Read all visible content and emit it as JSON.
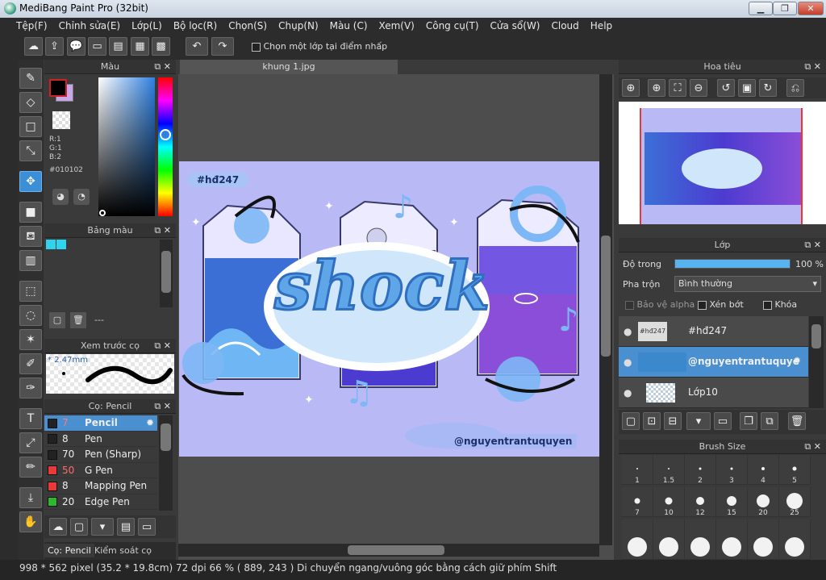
{
  "title": "MediBang Paint Pro (32bit)",
  "window_buttons": {
    "minimize": "▁",
    "maximize": "❐",
    "close": "✕"
  },
  "menu": [
    "Tệp(F)",
    "Chỉnh sửa(E)",
    "Lớp(L)",
    "Bộ lọc(R)",
    "Chọn(S)",
    "Chụp(N)",
    "Màu (C)",
    "Xem(V)",
    "Công cụ(T)",
    "Cửa sổ(W)",
    "Cloud",
    "Help"
  ],
  "toolbar": {
    "select_layer_label": "Chọn một lớp tại điểm nhấp"
  },
  "color_panel": {
    "title": "Màu",
    "r": "R:1",
    "g": "G:1",
    "b": "B:2",
    "hex": "#010102",
    "fg_color": "#010102",
    "bg_color": "#c8a7e8"
  },
  "palette_panel": {
    "title": "Bảng màu",
    "value": "---",
    "swatch1": "#2fd3ee",
    "swatch2": "#2fd3ee"
  },
  "brush_preview": {
    "title": "Xem trước cọ",
    "size": "2.47mm"
  },
  "brush_panel": {
    "title": "Cọ: Pencil",
    "items": [
      {
        "size": "7",
        "name": "Pencil",
        "color": "#222222",
        "size_color": "#ff7a7a"
      },
      {
        "size": "8",
        "name": "Pen",
        "color": "#222222",
        "size_color": "#eeeeee"
      },
      {
        "size": "70",
        "name": "Pen (Sharp)",
        "color": "#222222",
        "size_color": "#eeeeee"
      },
      {
        "size": "50",
        "name": "G Pen",
        "color": "#e83a3a",
        "size_color": "#ff6b6b"
      },
      {
        "size": "8",
        "name": "Mapping Pen",
        "color": "#e83a3a",
        "size_color": "#eeeeee"
      },
      {
        "size": "20",
        "name": "Edge Pen",
        "color": "#2cb82c",
        "size_color": "#eeeeee"
      }
    ],
    "tabs": [
      "Cọ: Pencil",
      "Kiểm soát cọ"
    ]
  },
  "document_tab": "khung 1.jpg",
  "artwork": {
    "hashtag": "#hđ247",
    "main_text": "shock",
    "watermark": "@nguyentrantuquyen",
    "bg": "#b9b9f5"
  },
  "navigator": {
    "title": "Hoa tiêu"
  },
  "layer_panel": {
    "title": "Lớp",
    "opacity_label": "Độ trong",
    "opacity_value": "100 %",
    "opacity_fraction": 1.0,
    "blend_label": "Pha trộn",
    "blend_value": "Bình thường",
    "protect_alpha": "Bảo vệ alpha",
    "clipping": "Xén bớt",
    "lock": "Khóa",
    "layers": [
      {
        "name": "#hđ247",
        "thumb_text": "#hđ247"
      },
      {
        "name": "@nguyentrantuquye"
      },
      {
        "name": "Lớp10"
      }
    ]
  },
  "brush_size": {
    "title": "Brush Size",
    "sizes": [
      "1",
      "1.5",
      "2",
      "3",
      "4",
      "5",
      "7",
      "10",
      "12",
      "15",
      "20",
      "25"
    ]
  },
  "status": {
    "pixels": "998 * 562 pixel",
    "cm": "(35.2 * 19.8cm)",
    "dpi": "72 dpi",
    "zoom": "66 %",
    "coords": "( 889, 243 )",
    "hint": "Di chuyển ngang/vuông góc bằng cách giữ phím Shift"
  }
}
